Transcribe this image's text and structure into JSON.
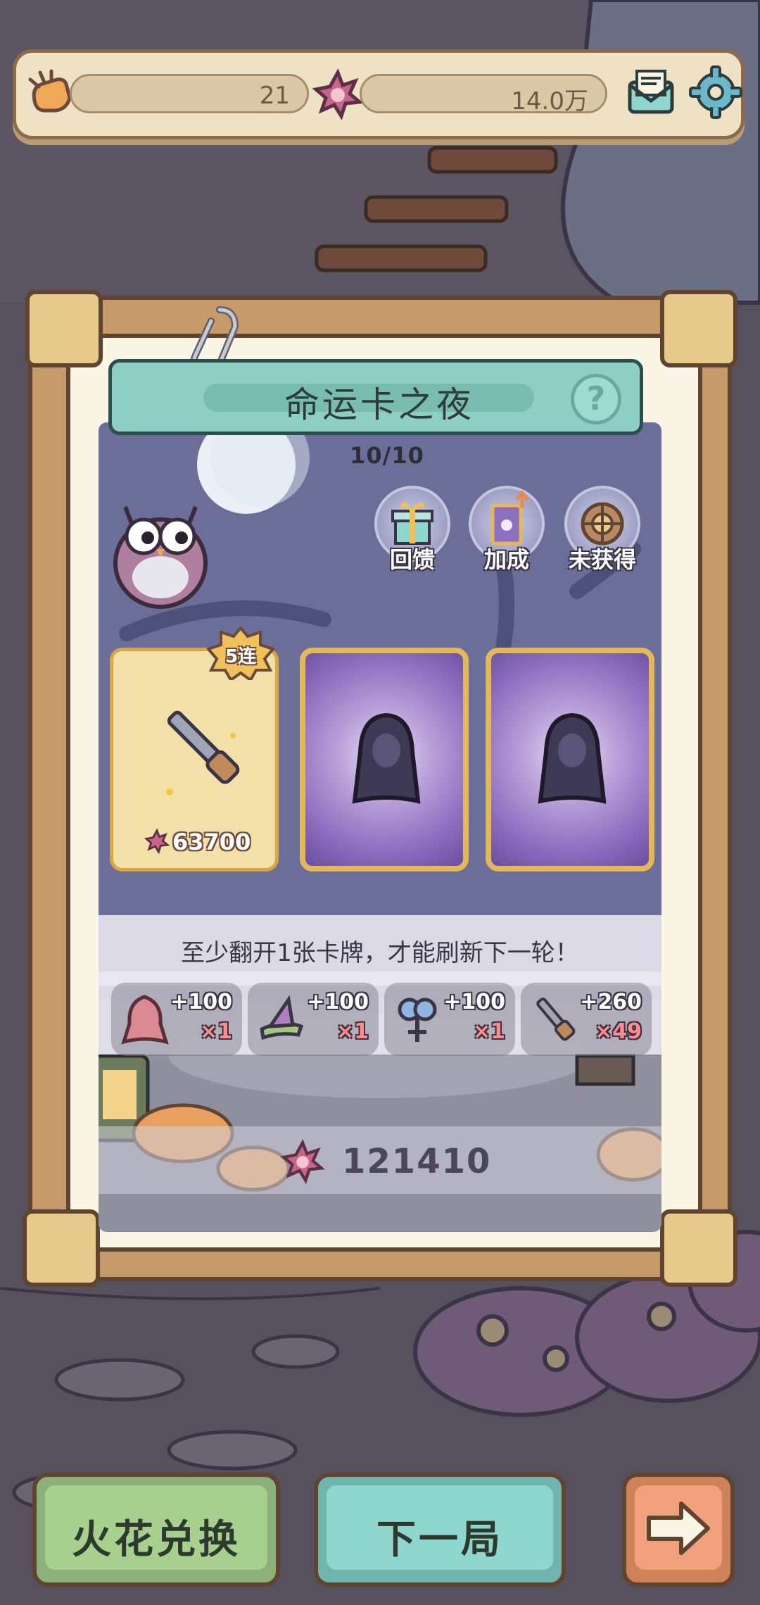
{
  "resources": {
    "gloves": {
      "icon": "glove-hand-icon",
      "value": "21"
    },
    "sparks": {
      "icon": "spark-flame-icon",
      "value": "14.0万"
    }
  },
  "header_icons": [
    "mail-icon",
    "gear-icon"
  ],
  "event": {
    "title": "命运卡之夜",
    "progress": "10/10",
    "buttons": [
      {
        "label": "回馈",
        "icon": "gift-box-icon"
      },
      {
        "label": "加成",
        "icon": "bonus-card-icon"
      },
      {
        "label": "未获得",
        "icon": "shield-wheel-icon"
      }
    ]
  },
  "cards": {
    "revealed": {
      "badge": "5连",
      "item_icon": "shotgun-icon",
      "price": "63700"
    },
    "hidden_icons": [
      "hooded-figure-icon",
      "hooded-figure-icon"
    ]
  },
  "notice": "至少翻开1张卡牌，才能刷新下一轮！",
  "rewards": [
    {
      "icon": "red-hood-icon",
      "plus": "+100",
      "mult": "×1"
    },
    {
      "icon": "witch-hat-icon",
      "plus": "+100",
      "mult": "×1"
    },
    {
      "icon": "blue-charm-icon",
      "plus": "+100",
      "mult": "×1"
    },
    {
      "icon": "shotgun-icon",
      "plus": "+260",
      "mult": "×49"
    }
  ],
  "total": {
    "icon": "spark-flame-icon",
    "value": "121410"
  },
  "bottom_buttons": {
    "exchange": "火花兑换",
    "next_round": "下一局",
    "arrow_icon": "arrow-right-icon"
  },
  "colors": {
    "teal_banner": "#8ecfc3",
    "exchange_green": "#a7cf8e",
    "next_teal": "#8fd6cf",
    "arrow_orange": "#f0a07a",
    "card_gold": "#e2b85a"
  }
}
